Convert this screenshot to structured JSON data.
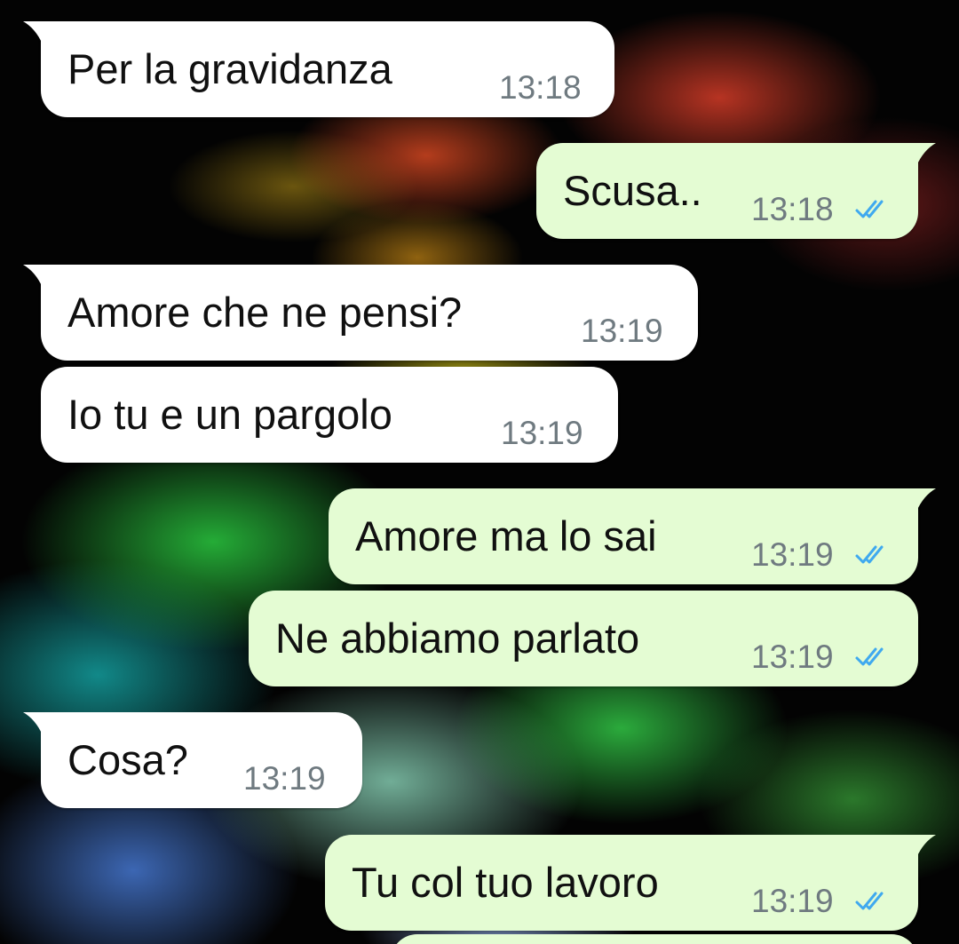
{
  "colors": {
    "incoming_bubble": "#ffffff",
    "outgoing_bubble": "#e4fcd3",
    "timestamp": "#6f7a80",
    "read_ticks": "#3fa9ef"
  },
  "messages": [
    {
      "direction": "incoming",
      "text": "Per la gravidanza",
      "time": "13:18"
    },
    {
      "direction": "outgoing",
      "text": "Scusa..",
      "time": "13:18",
      "status": "read-ticks-icon"
    },
    {
      "direction": "incoming",
      "text": "Amore che ne pensi?",
      "time": "13:19"
    },
    {
      "direction": "incoming",
      "text": "Io tu e un pargolo",
      "time": "13:19"
    },
    {
      "direction": "outgoing",
      "text": "Amore ma lo sai",
      "time": "13:19",
      "status": "read-ticks-icon"
    },
    {
      "direction": "outgoing",
      "text": "Ne abbiamo parlato",
      "time": "13:19",
      "status": "read-ticks-icon"
    },
    {
      "direction": "incoming",
      "text": "Cosa?",
      "time": "13:19"
    },
    {
      "direction": "outgoing",
      "text": "Tu col tuo lavoro",
      "time": "13:19",
      "status": "read-ticks-icon"
    }
  ]
}
